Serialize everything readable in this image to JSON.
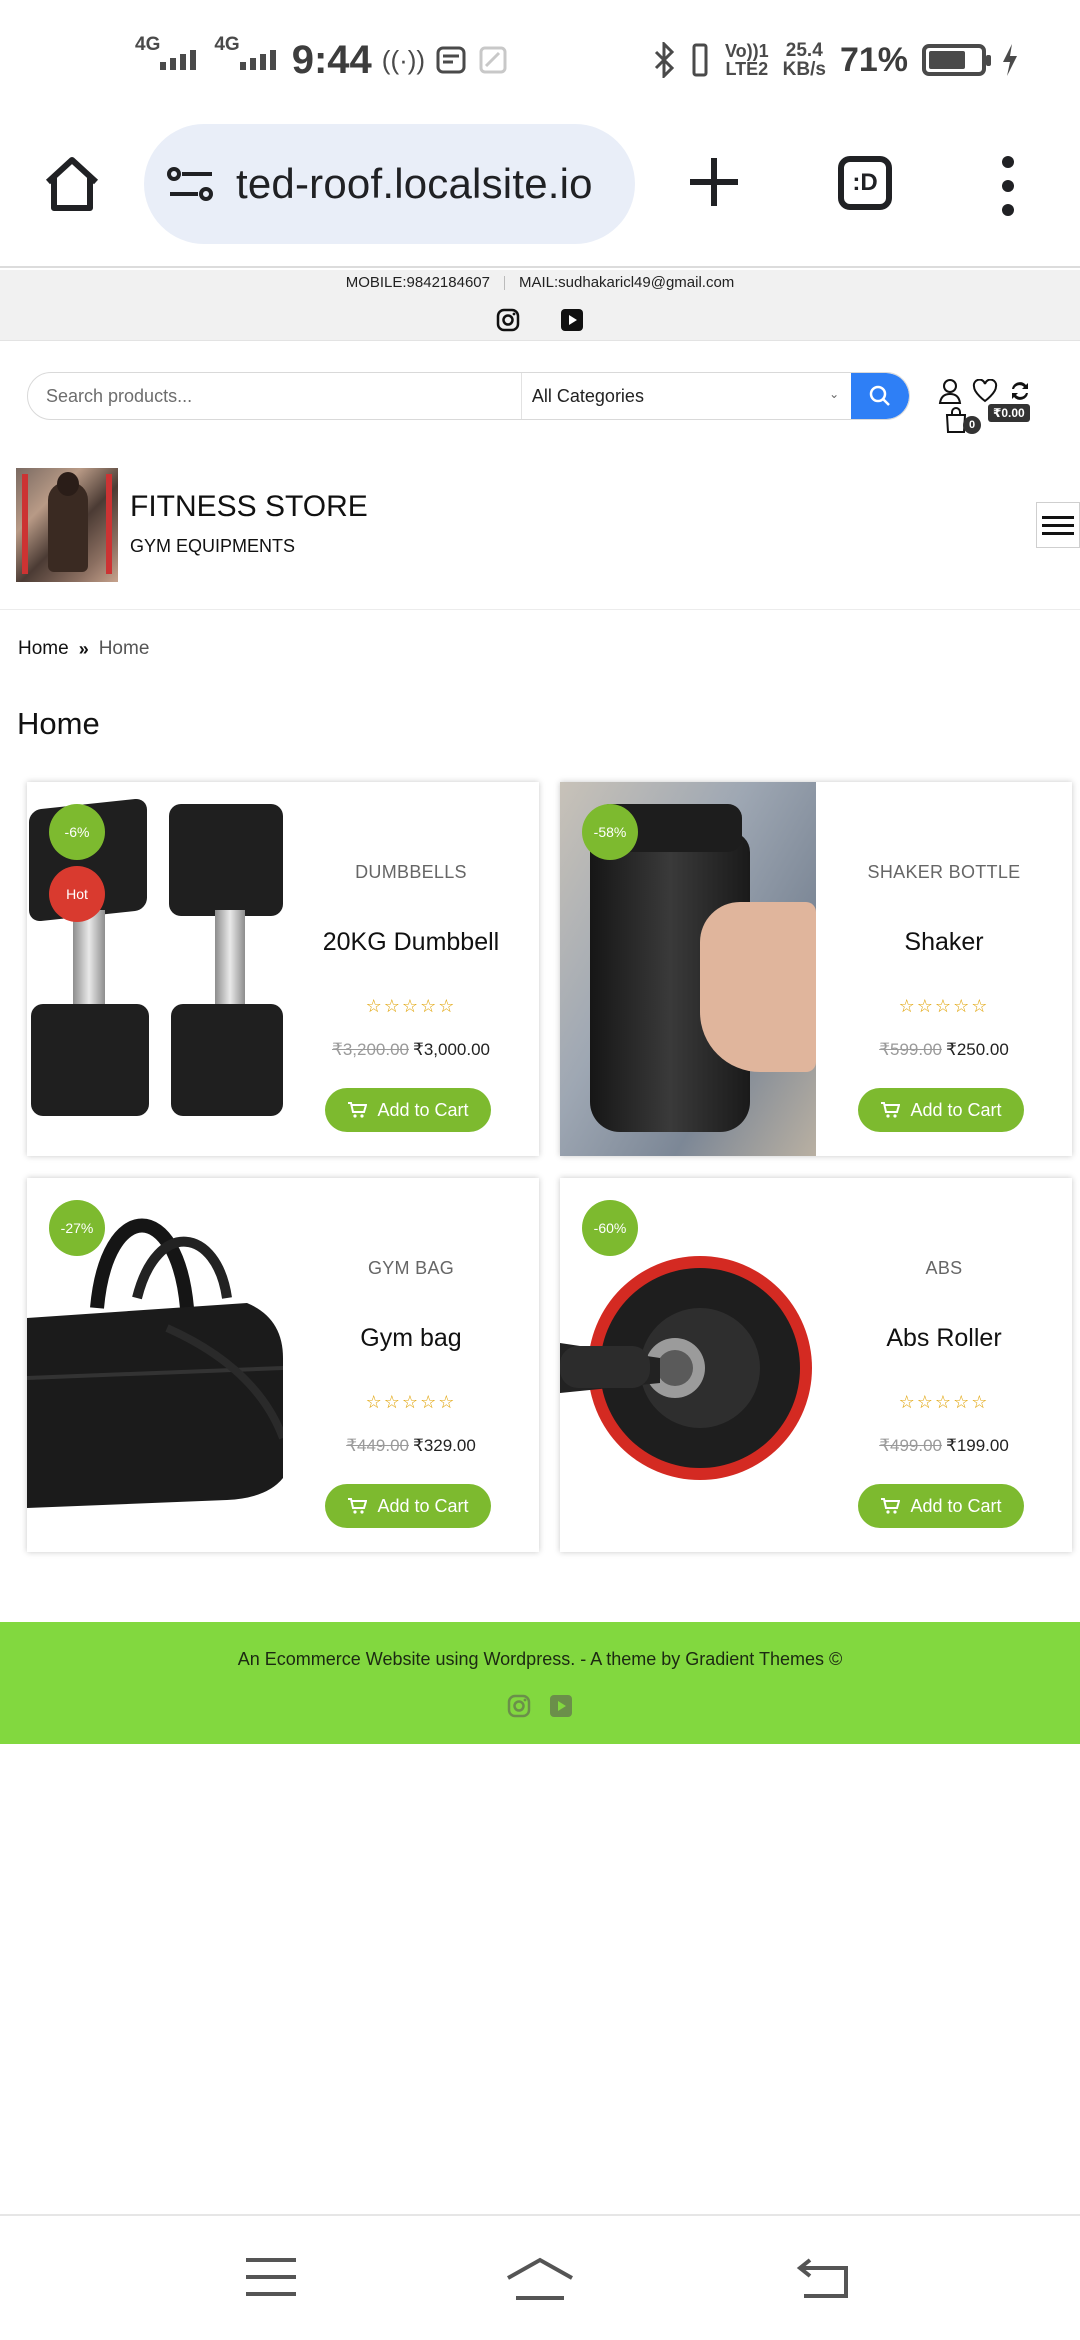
{
  "status_bar": {
    "network1": "4G",
    "network2": "4G",
    "time": "9:44",
    "volte": "Vo))1",
    "lte": "LTE2",
    "speed_value": "25.4",
    "speed_unit": "KB/s",
    "battery_pct": "71%",
    "battery_level": 0.71
  },
  "browser": {
    "url": "ted-roof.localsite.io",
    "tab_switcher_label": ":D"
  },
  "topbar": {
    "mobile": "MOBILE:9842184607",
    "mail": "MAIL:sudhakaricl49@gmail.com"
  },
  "search": {
    "placeholder": "Search products...",
    "category": "All Categories"
  },
  "header": {
    "cart_count": "0",
    "cart_total": "₹0.00"
  },
  "brand": {
    "title": "FITNESS STORE",
    "tagline": "GYM EQUIPMENTS"
  },
  "breadcrumb": {
    "home": "Home",
    "current": "Home"
  },
  "page": {
    "title": "Home"
  },
  "products": [
    {
      "category": "DUMBBELLS",
      "name": "20KG Dumbbell",
      "old_price": "₹3,200.00",
      "price": "₹3,000.00",
      "sale_badge": "-6%",
      "hot_badge": "Hot",
      "rating": 0
    },
    {
      "category": "SHAKER BOTTLE",
      "name": "Shaker",
      "old_price": "₹599.00",
      "price": "₹250.00",
      "sale_badge": "-58%",
      "rating": 0
    },
    {
      "category": "GYM BAG",
      "name": "Gym bag",
      "old_price": "₹449.00",
      "price": "₹329.00",
      "sale_badge": "-27%",
      "rating": 0
    },
    {
      "category": "ABS",
      "name": "Abs Roller",
      "old_price": "₹499.00",
      "price": "₹199.00",
      "sale_badge": "-60%",
      "rating": 0
    }
  ],
  "add_to_cart_label": "Add to Cart",
  "footer": {
    "text": "An Ecommerce Website using Wordpress. - A theme by Gradient Themes ©"
  },
  "colors": {
    "accent_green": "#7dba2f",
    "footer_green": "#82d83f",
    "search_blue": "#2e7ff6",
    "hot_red": "#d93a2f"
  }
}
